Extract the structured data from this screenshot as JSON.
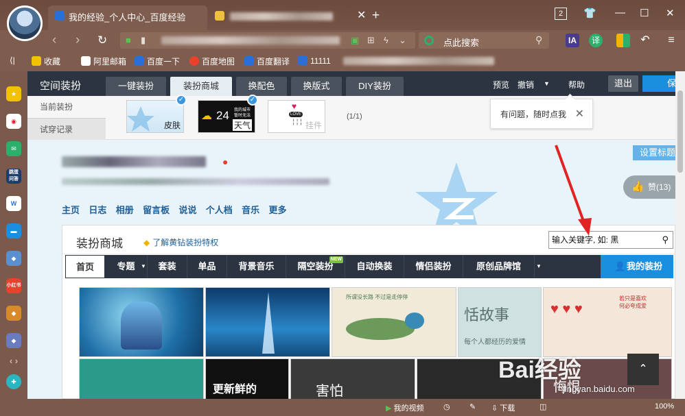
{
  "browser": {
    "active_tab_title": "我的经验_个人中心_百度经验",
    "tab_counter": "2",
    "search_label": "点此搜索",
    "bookmarks": [
      "收藏",
      "阿里邮箱",
      "百度一下",
      "百度地图",
      "百度翻译",
      "11111"
    ],
    "sidebar_labels": [
      "跳蛋\n问答",
      "小红书"
    ],
    "status": {
      "video": "我的视频",
      "download": "下载",
      "zoom": "100%"
    }
  },
  "qzone": {
    "title": "空间装扮",
    "tabs": [
      "一键装扮",
      "装扮商城",
      "换配色",
      "换版式",
      "DIY装扮"
    ],
    "links": {
      "preview": "预览",
      "undo": "撤销",
      "help": "帮助"
    },
    "exit": "退出",
    "save": "保",
    "side_tabs": [
      "当前装扮",
      "试穿记录"
    ],
    "thumbs": [
      {
        "label": "皮肤"
      },
      {
        "label": "天气",
        "temp": "24",
        "note1": "我的城市",
        "note2": "暂时无法"
      },
      {
        "label": "挂件",
        "love": "LOVE"
      }
    ],
    "pager": "(1/1)",
    "help_tip": "有问题，随时点我",
    "setting_title": "设置标题",
    "like": "赞(13)",
    "nav": [
      "主页",
      "日志",
      "相册",
      "留言板",
      "说说",
      "个人档",
      "音乐",
      "更多"
    ]
  },
  "mall": {
    "title": "装扮商城",
    "vip_link": "了解黄钻装扮特权",
    "search_value": "输入关键字, 如: 黑",
    "tabs": [
      "首页",
      "专题",
      "套装",
      "单品",
      "背景音乐",
      "隔空装扮",
      "自动换装",
      "情侣装扮",
      "原创品牌馆"
    ],
    "new_badge": "NEW",
    "my_skin": "我的装扮",
    "images": [
      {
        "caption": ""
      },
      {
        "caption": ""
      },
      {
        "caption": "所谓没长路   不过是走停停"
      },
      {
        "caption": "恬故事",
        "sub": "每个人都经历的爱情"
      },
      {
        "caption": "若只是喜欢\n何必夸成爱"
      },
      {
        "caption": ""
      },
      {
        "caption": "更新鲜的"
      },
      {
        "caption": "害怕"
      },
      {
        "caption": ""
      },
      {
        "caption": "悔恨"
      }
    ]
  },
  "watermark": {
    "main": "Bai经验",
    "sub": "jingyan.baidu.com"
  }
}
